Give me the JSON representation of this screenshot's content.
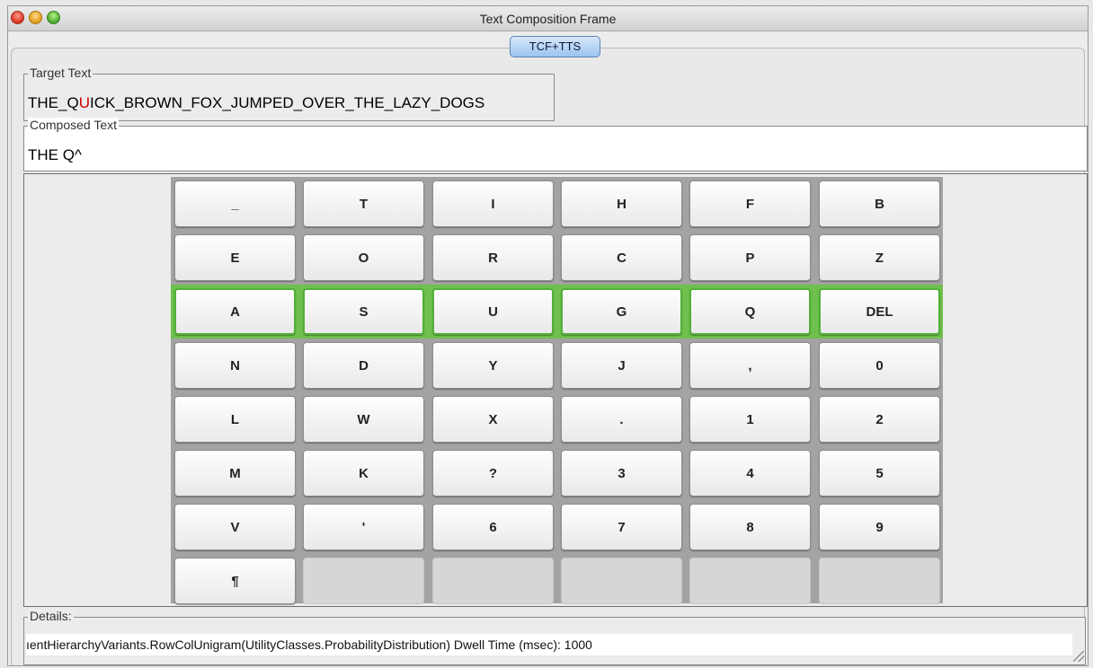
{
  "window": {
    "title": "Text Composition Frame"
  },
  "tabs": [
    {
      "label": "TCF+TTS",
      "selected": true
    }
  ],
  "target_text": {
    "legend": "Target Text",
    "before": "THE_Q",
    "highlight": "U",
    "after": "ICK_BROWN_FOX_JUMPED_OVER_THE_LAZY_DOGS",
    "highlight_color": "#d00000"
  },
  "composed_text": {
    "legend": "Composed Text",
    "value": "THE Q^"
  },
  "keyboard": {
    "highlighted_row": 2,
    "highlight_color": "#6fc04e",
    "rows": [
      [
        "_",
        "T",
        "I",
        "H",
        "F",
        "B"
      ],
      [
        "E",
        "O",
        "R",
        "C",
        "P",
        "Z"
      ],
      [
        "A",
        "S",
        "U",
        "G",
        "Q",
        "DEL"
      ],
      [
        "N",
        "D",
        "Y",
        "J",
        ",",
        "0"
      ],
      [
        "L",
        "W",
        "X",
        ".",
        "1",
        "2"
      ],
      [
        "M",
        "K",
        "?",
        "3",
        "4",
        "5"
      ],
      [
        "V",
        "'",
        "6",
        "7",
        "8",
        "9"
      ],
      [
        "¶",
        "",
        "",
        "",
        "",
        ""
      ]
    ]
  },
  "details": {
    "legend": "Details:",
    "text": "ıentHierarchyVariants.RowColUnigram(UtilityClasses.ProbabilityDistribution) Dwell Time (msec): 1000"
  }
}
